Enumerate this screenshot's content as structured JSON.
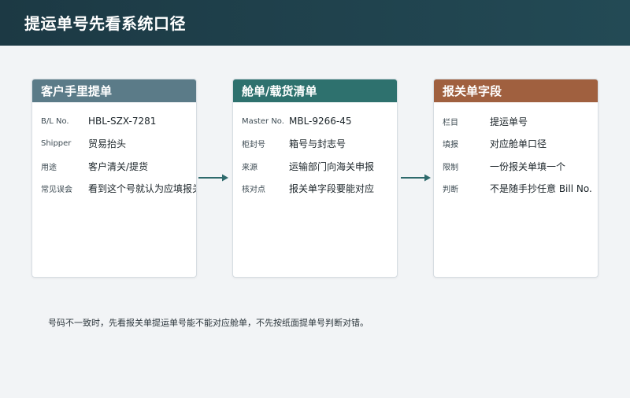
{
  "page": {
    "title": "提运单号先看系统口径"
  },
  "cards": [
    {
      "title": "客户手里提单",
      "color": "#5b7b88",
      "rows": [
        {
          "label": "B/L No.",
          "value": "HBL-SZX-7281"
        },
        {
          "label": "Shipper",
          "value": "贸易抬头"
        },
        {
          "label": "用途",
          "value": "客户清关/提货"
        },
        {
          "label": "常见误会",
          "value": "看到这个号就认为应填报关单"
        }
      ]
    },
    {
      "title": "舱单/载货清单",
      "color": "#2e716e",
      "rows": [
        {
          "label": "Master No.",
          "value": "MBL-9266-45"
        },
        {
          "label": "柜封号",
          "value": "箱号与封志号"
        },
        {
          "label": "来源",
          "value": "运输部门向海关申报"
        },
        {
          "label": "核对点",
          "value": "报关单字段要能对应"
        }
      ]
    },
    {
      "title": "报关单字段",
      "color": "#a0603f",
      "rows": [
        {
          "label": "栏目",
          "value": "提运单号"
        },
        {
          "label": "填报",
          "value": "对应舱单口径"
        },
        {
          "label": "限制",
          "value": "一份报关单填一个"
        },
        {
          "label": "判断",
          "value": "不是随手抄任意 Bill No."
        }
      ]
    }
  ],
  "footnote": "号码不一致时，先看报关单提运单号能不能对应舱单，不先按纸面提单号判断对错。",
  "arrow_color": "#2e6a6c"
}
